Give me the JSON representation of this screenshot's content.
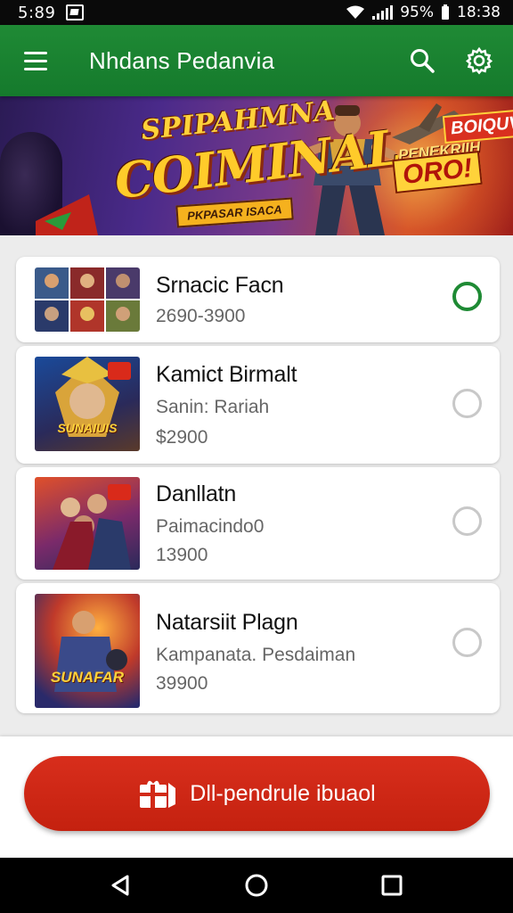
{
  "status_bar": {
    "time": "5:89",
    "battery": "95%",
    "clock": "18:38"
  },
  "app_bar": {
    "title": "Nhdans Pedanvia",
    "icons": [
      "menu-icon",
      "search-icon",
      "settings-icon"
    ]
  },
  "banner": {
    "title_line1": "SPIPAHMNA",
    "title_line2": "COIMINAL",
    "subtitle": "PKPASAR ISACA",
    "badge_right": "BOIQUV",
    "tagline_right": "PENEKRIIH",
    "oro": "ORO!"
  },
  "items": [
    {
      "title": "Srnacic Facn",
      "line1": "2690-3900",
      "line2": "",
      "selected": true
    },
    {
      "title": "Kamict Birmalt",
      "line1": "Sanin: Rariah",
      "line2": "$2900",
      "selected": false
    },
    {
      "title": "Danllatn",
      "line1": "Paimacindo0",
      "line2": "13900",
      "selected": false
    },
    {
      "title": "Natarsiit Plagn",
      "line1": "Kampanata. Pesdaiman",
      "line2": "39900",
      "selected": false
    }
  ],
  "thumbnail_labels": {
    "item2": "SUNAIUIS",
    "item4": "SUNAFAR"
  },
  "cta": {
    "label": "Dll-pendrule ibuaol",
    "icon": "gift-icon"
  },
  "colors": {
    "primary_green": "#1e8a34",
    "cta_red": "#d22a18"
  }
}
